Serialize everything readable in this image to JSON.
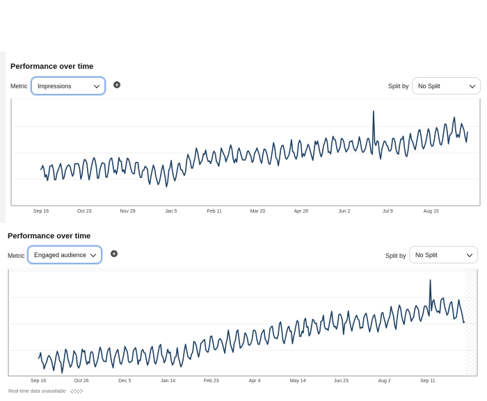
{
  "panels": [
    {
      "title": "Performance over time",
      "metric_label": "Metric",
      "metric_value": "Impressions",
      "add_metric_icon": "plus-circle-icon",
      "split_label": "Split by",
      "split_value": "No Split"
    },
    {
      "title": "Performance over time",
      "metric_label": "Metric",
      "metric_value": "Engaged audience",
      "add_metric_icon": "plus-circle-icon",
      "split_label": "Split by",
      "split_value": "No Split"
    }
  ],
  "footer": {
    "realtime_note": "Real-time data unavailable"
  },
  "colors": {
    "line": "#1c3f63",
    "focus_ring": "#8fb3ea",
    "grid": "#efefef"
  },
  "chart_data": [
    {
      "type": "line",
      "title": "Performance over time",
      "series": [
        {
          "name": "Impressions"
        }
      ],
      "xlabel": "",
      "ylabel": "",
      "x_tick_labels": [
        "Sep 16",
        "Oct 23",
        "Nov 29",
        "Jan 5",
        "Feb 11",
        "Mar 20",
        "Apr 26",
        "Jun 2",
        "Jul 9",
        "Aug 15"
      ],
      "y_tick_labels": [],
      "ylim": [
        0,
        100
      ],
      "grid": true,
      "legend": "none",
      "trend_keypoints": [
        {
          "t": 0.0,
          "v": 28
        },
        {
          "t": 0.1,
          "v": 33
        },
        {
          "t": 0.2,
          "v": 34
        },
        {
          "t": 0.28,
          "v": 25
        },
        {
          "t": 0.33,
          "v": 30
        },
        {
          "t": 0.36,
          "v": 42
        },
        {
          "t": 0.45,
          "v": 45
        },
        {
          "t": 0.55,
          "v": 46
        },
        {
          "t": 0.63,
          "v": 50
        },
        {
          "t": 0.71,
          "v": 57
        },
        {
          "t": 0.77,
          "v": 52
        },
        {
          "t": 0.85,
          "v": 55
        },
        {
          "t": 0.92,
          "v": 63
        },
        {
          "t": 1.0,
          "v": 70
        }
      ],
      "amplitude": 9,
      "spikes": [
        {
          "t": 0.78,
          "v": 88
        },
        {
          "t": 0.97,
          "v": 82
        }
      ]
    },
    {
      "type": "line",
      "title": "Performance over time",
      "series": [
        {
          "name": "Engaged audience"
        }
      ],
      "xlabel": "",
      "ylabel": "",
      "x_tick_labels": [
        "Sep 16",
        "Oct 26",
        "Dec 5",
        "Jan 14",
        "Feb 23",
        "Apr 4",
        "May 14",
        "Jun 23",
        "Aug 2",
        "Sep 11"
      ],
      "y_tick_labels": [],
      "ylim": [
        0,
        100
      ],
      "grid": true,
      "legend": "none",
      "realtime_unavailable_region": true,
      "trend_keypoints": [
        {
          "t": 0.0,
          "v": 12
        },
        {
          "t": 0.15,
          "v": 17
        },
        {
          "t": 0.3,
          "v": 18
        },
        {
          "t": 0.33,
          "v": 14
        },
        {
          "t": 0.38,
          "v": 28
        },
        {
          "t": 0.5,
          "v": 34
        },
        {
          "t": 0.6,
          "v": 42
        },
        {
          "t": 0.7,
          "v": 52
        },
        {
          "t": 0.78,
          "v": 50
        },
        {
          "t": 0.88,
          "v": 60
        },
        {
          "t": 0.95,
          "v": 66
        },
        {
          "t": 1.0,
          "v": 60
        }
      ],
      "amplitude": 9,
      "spikes": [
        {
          "t": 0.92,
          "v": 92
        }
      ]
    }
  ]
}
